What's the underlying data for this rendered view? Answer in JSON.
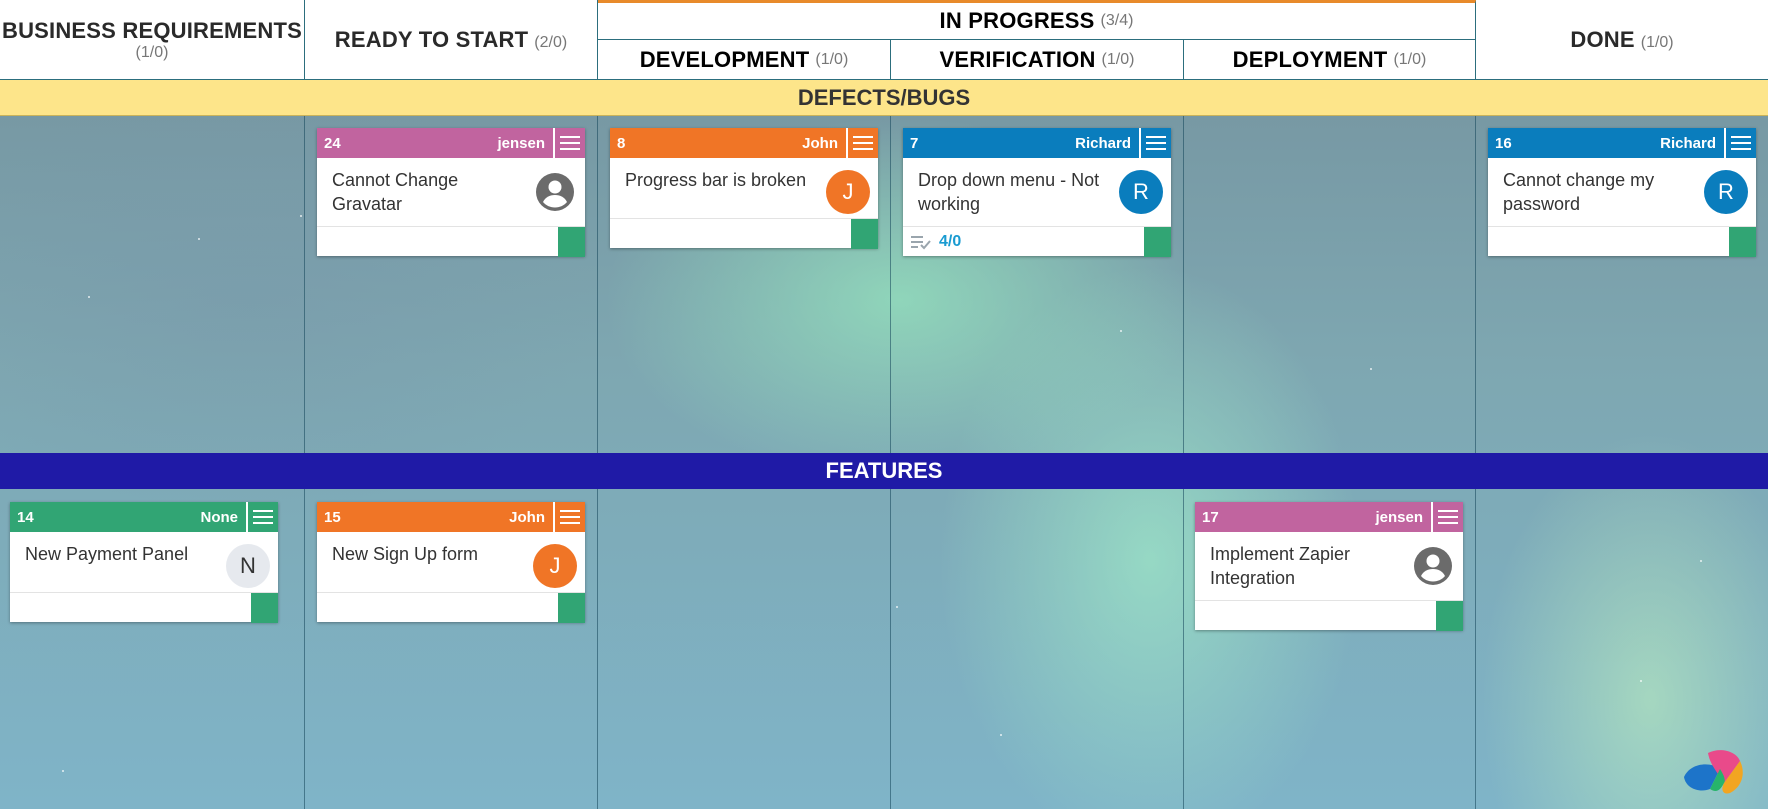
{
  "columns": {
    "business": {
      "name": "BUSINESS REQUIREMENTS",
      "count": "(1/0)"
    },
    "ready": {
      "name": "READY TO START",
      "count": "(2/0)"
    },
    "in_progress": {
      "name": "IN PROGRESS",
      "count": "(3/4)"
    },
    "development": {
      "name": "DEVELOPMENT",
      "count": "(1/0)"
    },
    "verification": {
      "name": "VERIFICATION",
      "count": "(1/0)"
    },
    "deployment": {
      "name": "DEPLOYMENT",
      "count": "(1/0)"
    },
    "done": {
      "name": "DONE",
      "count": "(1/0)"
    }
  },
  "lanes": {
    "defects": "DEFECTS/BUGS",
    "features": "FEATURES"
  },
  "colors": {
    "pink": "#c1649f",
    "orange": "#f07526",
    "blue": "#0a7dbd",
    "green": "#31a574",
    "defects_lane": "#fde58a",
    "features_lane": "#1f1aa6"
  },
  "cards": {
    "c24": {
      "id": "24",
      "owner": "jensen",
      "title": "Cannot Change Gravatar",
      "avatar": "user-icon"
    },
    "c8": {
      "id": "8",
      "owner": "John",
      "title": "Progress bar is broken",
      "avatar": "J"
    },
    "c7": {
      "id": "7",
      "owner": "Richard",
      "title": "Drop down menu - Not working",
      "avatar": "R",
      "checklist": "4/0"
    },
    "c16": {
      "id": "16",
      "owner": "Richard",
      "title": "Cannot change my password",
      "avatar": "R"
    },
    "c14": {
      "id": "14",
      "owner": "None",
      "title": "New Payment Panel",
      "avatar": "N"
    },
    "c15": {
      "id": "15",
      "owner": "John",
      "title": "New Sign Up form",
      "avatar": "J"
    },
    "c17": {
      "id": "17",
      "owner": "jensen",
      "title": "Implement Zapier Integration",
      "avatar": "user-icon"
    }
  }
}
